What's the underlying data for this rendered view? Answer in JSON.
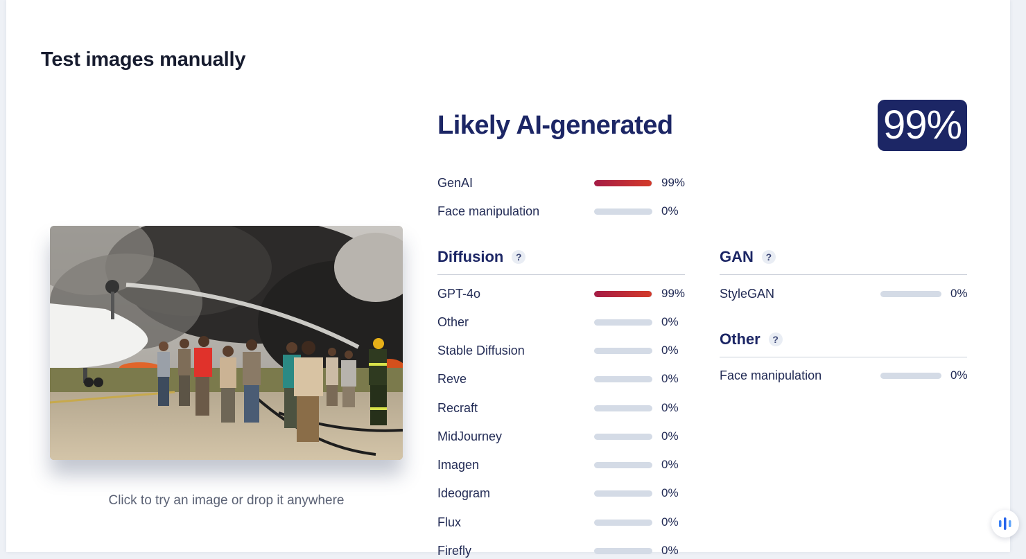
{
  "section_title": "Test images manually",
  "upload_hint": "Click to try an image or drop it anywhere",
  "result": {
    "verdict": "Likely AI-generated",
    "score": "99%"
  },
  "summary": [
    {
      "label": "GenAI",
      "pct": "99%",
      "fill": 0.99
    },
    {
      "label": "Face manipulation",
      "pct": "0%",
      "fill": 0
    }
  ],
  "groups": {
    "diffusion": {
      "title": "Diffusion",
      "help": "?",
      "items": [
        {
          "label": "GPT-4o",
          "pct": "99%",
          "fill": 0.99
        },
        {
          "label": "Other",
          "pct": "0%",
          "fill": 0
        },
        {
          "label": "Stable Diffusion",
          "pct": "0%",
          "fill": 0
        },
        {
          "label": "Reve",
          "pct": "0%",
          "fill": 0
        },
        {
          "label": "Recraft",
          "pct": "0%",
          "fill": 0
        },
        {
          "label": "MidJourney",
          "pct": "0%",
          "fill": 0
        },
        {
          "label": "Imagen",
          "pct": "0%",
          "fill": 0
        },
        {
          "label": "Ideogram",
          "pct": "0%",
          "fill": 0
        },
        {
          "label": "Flux",
          "pct": "0%",
          "fill": 0
        },
        {
          "label": "Firefly",
          "pct": "0%",
          "fill": 0
        }
      ]
    },
    "gan": {
      "title": "GAN",
      "help": "?",
      "items": [
        {
          "label": "StyleGAN",
          "pct": "0%",
          "fill": 0
        }
      ]
    },
    "other": {
      "title": "Other",
      "help": "?",
      "items": [
        {
          "label": "Face manipulation",
          "pct": "0%",
          "fill": 0
        }
      ]
    }
  },
  "colors": {
    "brand_navy": "#1c2665",
    "bar_fill_start": "#a51c45",
    "bar_fill_end": "#d33a2a",
    "bar_track": "#d4dbe6"
  },
  "icons": {
    "fab": "audio-bars-icon"
  }
}
